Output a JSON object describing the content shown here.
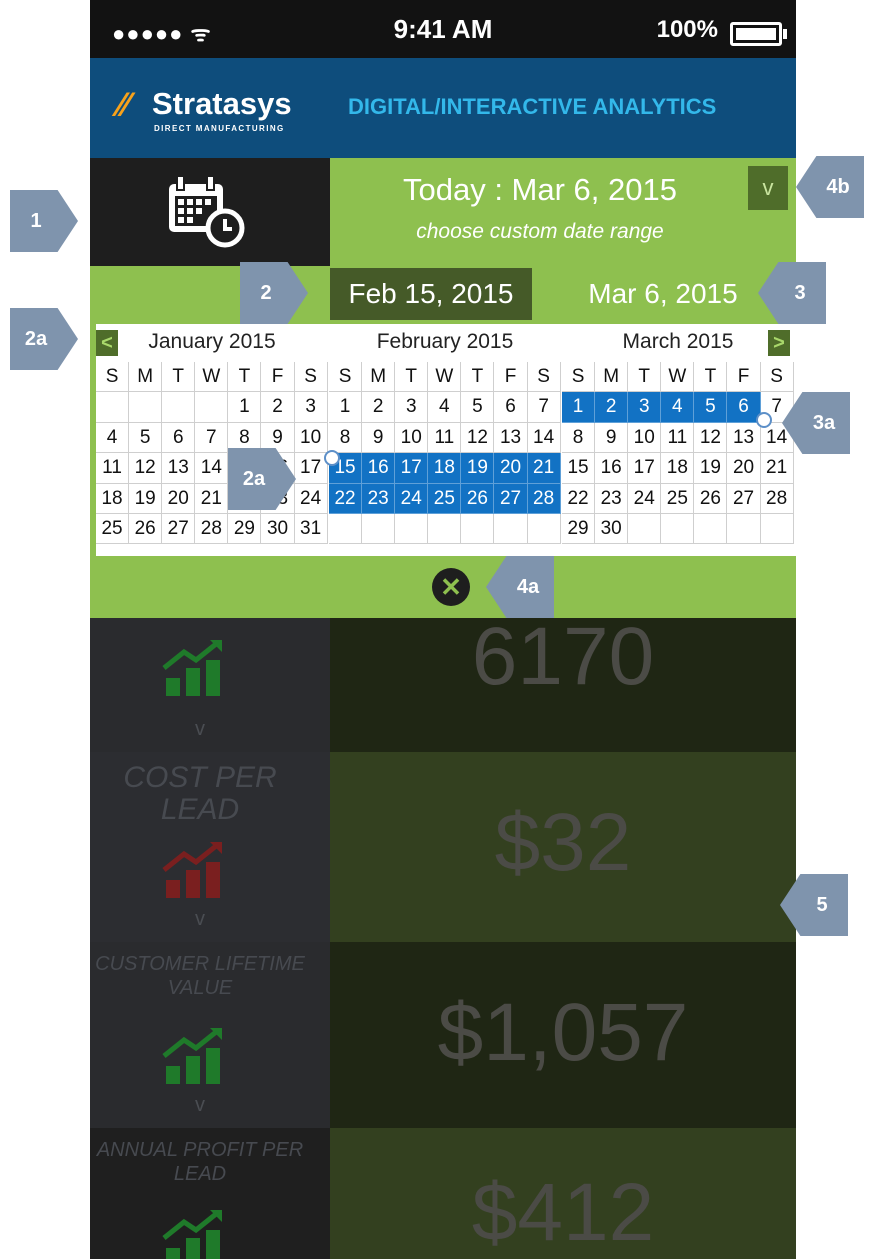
{
  "status_bar": {
    "signal": "●●●●● ᯤ",
    "time": "9:41 AM",
    "battery": "100%"
  },
  "header": {
    "brand": "Stratasys",
    "brand_sub": "DIRECT MANUFACTURING",
    "title": "DIGITAL/INTERACTIVE ANALYTICS"
  },
  "date_panel": {
    "today_label": "Today :  Mar 6, 2015",
    "custom_range": "choose custom date range",
    "dropdown_glyph": "v",
    "start_date": "Feb 15, 2015",
    "end_date": "Mar 6, 2015",
    "calendar_icon": "calendar-clock-icon"
  },
  "calendar": {
    "prev": "<",
    "next": ">",
    "weekdays": [
      "S",
      "M",
      "T",
      "W",
      "T",
      "F",
      "S"
    ],
    "months": [
      {
        "title": "January  2015",
        "offset": 4,
        "days": 31,
        "selected": []
      },
      {
        "title": "February  2015",
        "offset": 0,
        "days": 28,
        "selected": [
          15,
          16,
          17,
          18,
          19,
          20,
          21,
          22,
          23,
          24,
          25,
          26,
          27,
          28
        ]
      },
      {
        "title": "March  2015",
        "offset": 0,
        "days": 30,
        "selected": [
          1,
          2,
          3,
          4,
          5,
          6
        ]
      }
    ],
    "close_glyph": "✕",
    "selection_color": "#1272c4"
  },
  "metrics": [
    {
      "label": "",
      "value": "6170",
      "trend": "up-green",
      "chevron": "v"
    },
    {
      "label": "COST PER LEAD",
      "value": "$32",
      "trend": "up-red",
      "chevron": "v"
    },
    {
      "label": "CUSTOMER LIFETIME VALUE",
      "value": "$1,057",
      "trend": "up-green",
      "chevron": "v"
    },
    {
      "label": "ANNUAL  PROFIT PER LEAD",
      "value": "$412",
      "trend": "up-green",
      "chevron": ""
    }
  ],
  "annotations": [
    "1",
    "2",
    "2a",
    "2a",
    "3",
    "3a",
    "4a",
    "4b",
    "5"
  ],
  "colors": {
    "accent_green": "#8ec04f",
    "header_blue": "#0e4d7c",
    "title_blue": "#33b8ea",
    "dark_green": "#455a28"
  }
}
